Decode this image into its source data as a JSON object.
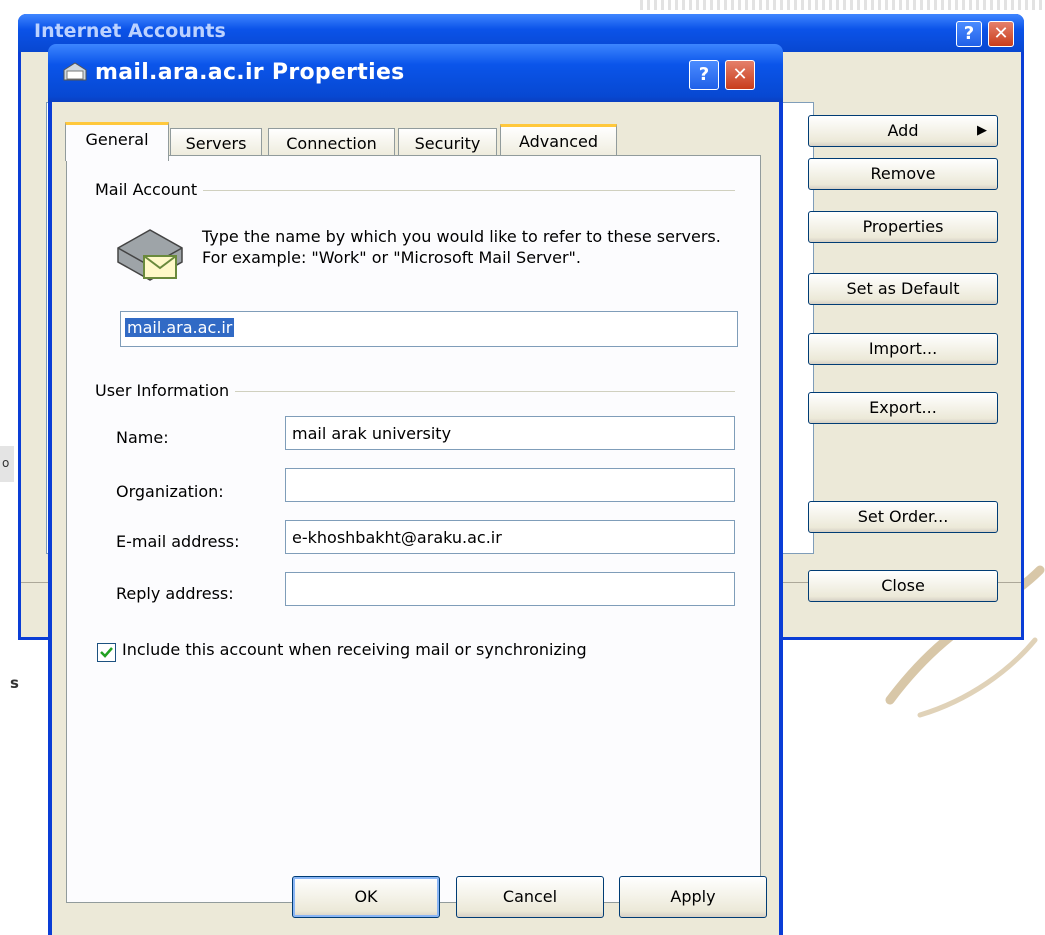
{
  "background": {
    "side_char_1": "o",
    "side_char_2": "s"
  },
  "outer_window": {
    "title": "Internet Accounts",
    "help_glyph": "?",
    "close_glyph": "✕",
    "buttons": {
      "add": "Add",
      "remove": "Remove",
      "properties": "Properties",
      "set_default": "Set as Default",
      "import": "Import...",
      "export": "Export...",
      "set_order": "Set Order...",
      "close": "Close"
    },
    "add_arrow": "▶"
  },
  "dialog": {
    "title": "mail.ara.ac.ir Properties",
    "help_glyph": "?",
    "close_glyph": "✕",
    "tabs": [
      "General",
      "Servers",
      "Connection",
      "Security",
      "Advanced"
    ],
    "mail_account": {
      "group_label": "Mail Account",
      "description": "Type the name by which you would like to refer to these servers.  For example: \"Work\" or \"Microsoft Mail Server\".",
      "account_name": "mail.ara.ac.ir"
    },
    "user_info": {
      "group_label": "User Information",
      "name_label": "Name:",
      "name_value": "mail arak university",
      "organization_label": "Organization:",
      "organization_value": "",
      "email_label": "E-mail address:",
      "email_value": "e-khoshbakht@araku.ac.ir",
      "reply_label": "Reply address:",
      "reply_value": ""
    },
    "include_checkbox": {
      "label": "Include this account when receiving mail or synchronizing",
      "checked": true
    },
    "buttons": {
      "ok": "OK",
      "cancel": "Cancel",
      "apply": "Apply"
    }
  }
}
